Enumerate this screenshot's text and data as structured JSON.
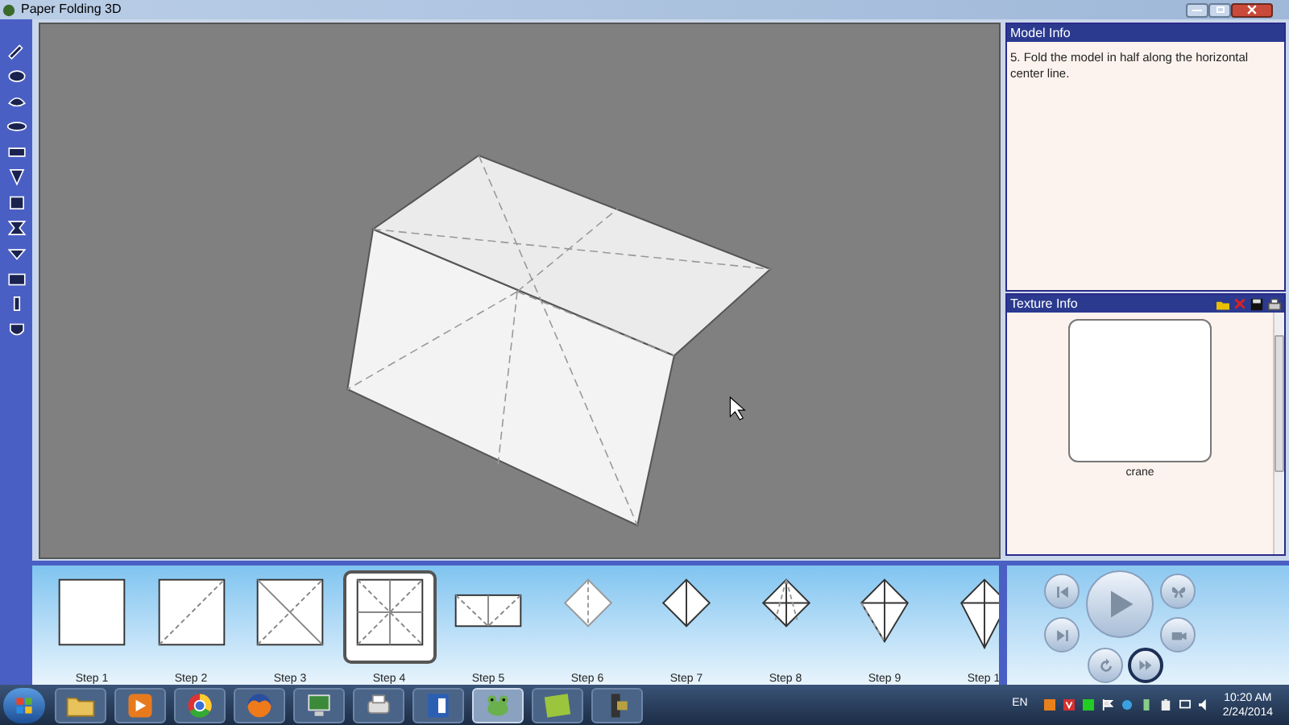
{
  "window": {
    "title": "Paper Folding 3D"
  },
  "model_info": {
    "title": "Model Info",
    "text": "5. Fold the model in half along the horizontal center line."
  },
  "texture_info": {
    "title": "Texture Info",
    "texture_name": "crane"
  },
  "steps": [
    {
      "label": "Step 1",
      "selected": false
    },
    {
      "label": "Step 2",
      "selected": false
    },
    {
      "label": "Step 3",
      "selected": false
    },
    {
      "label": "Step 4",
      "selected": true
    },
    {
      "label": "Step 5",
      "selected": false
    },
    {
      "label": "Step 6",
      "selected": false
    },
    {
      "label": "Step 7",
      "selected": false
    },
    {
      "label": "Step 8",
      "selected": false
    },
    {
      "label": "Step 9",
      "selected": false
    },
    {
      "label": "Step 1",
      "selected": false
    }
  ],
  "taskbar": {
    "apps": [
      {
        "kind": "folder",
        "selected": false
      },
      {
        "kind": "player",
        "selected": false
      },
      {
        "kind": "ball",
        "selected": false
      },
      {
        "kind": "globe",
        "selected": false
      },
      {
        "kind": "monitor",
        "selected": false
      },
      {
        "kind": "printer",
        "selected": false
      },
      {
        "kind": "document",
        "selected": false
      },
      {
        "kind": "frog",
        "selected": true
      },
      {
        "kind": "note",
        "selected": false
      },
      {
        "kind": "tool",
        "selected": false
      }
    ],
    "language": "EN",
    "time": "10:20 AM",
    "date": "2/24/2014"
  }
}
